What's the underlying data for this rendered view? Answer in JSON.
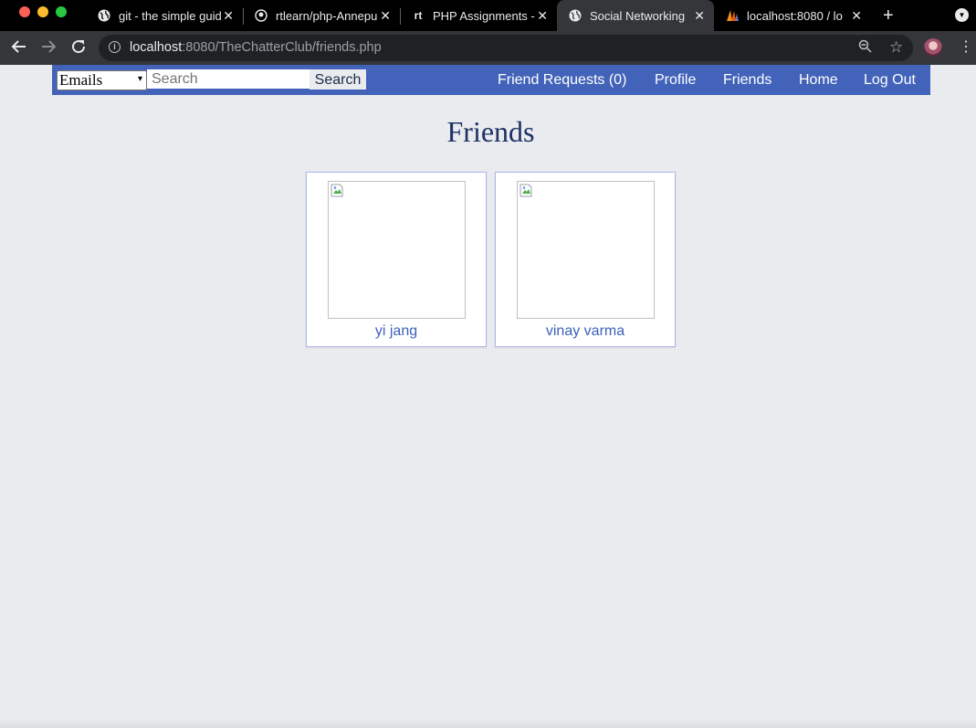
{
  "browser": {
    "tabs": [
      {
        "title": "git - the simple guide",
        "icon": "globe-icon",
        "active": false
      },
      {
        "title": "rtlearn/php-Annepu",
        "icon": "github-icon",
        "active": false
      },
      {
        "title": "PHP Assignments - rt",
        "icon": "rt-icon",
        "icon_text": "rt",
        "active": false
      },
      {
        "title": "Social Networking",
        "icon": "globe-icon",
        "active": true
      },
      {
        "title": "localhost:8080 / lo",
        "icon": "phpmyadmin-icon",
        "active": false
      }
    ],
    "address": {
      "host": "localhost",
      "rest": ":8080/TheChatterClub/friends.php"
    }
  },
  "navbar": {
    "filter_selected": "Emails",
    "search_placeholder": "Search",
    "search_button": "Search",
    "links": [
      {
        "label": "Friend Requests (0)"
      },
      {
        "label": "Profile"
      },
      {
        "label": "Friends"
      },
      {
        "label": "Home"
      },
      {
        "label": "Log Out"
      }
    ],
    "color": "#4263b9"
  },
  "page": {
    "title": "Friends",
    "background": "#e9ebee"
  },
  "friends": [
    {
      "name": "yi jang"
    },
    {
      "name": "vinay varma"
    }
  ],
  "colors": {
    "link": "#3b62b8",
    "title": "#1d3166"
  }
}
